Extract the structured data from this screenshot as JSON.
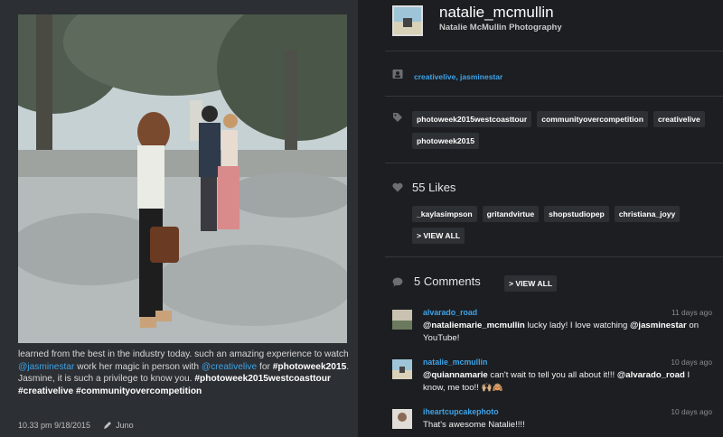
{
  "post": {
    "caption": {
      "part1": "learned from the best in the industry today. such an amazing experience to watch ",
      "mention1": "@jasminestar",
      "part2": " work her magic in person with ",
      "mention2": "@creativelive",
      "part3": " for ",
      "hashtag1": "#photoweek2015",
      "part4": ". Jasmine, it is such a privilege to know you. ",
      "hashtag2": "#photoweek2015westcoasttour",
      "hashtag3": "#creativelive",
      "hashtag4": "#communityovercompetition"
    },
    "timestamp": "10.33 pm 9/18/2015",
    "filter": "Juno"
  },
  "profile": {
    "username": "natalie_mcmullin",
    "fullname": "Natalie McMullin Photography"
  },
  "people": "creativelive, jasminestar",
  "tags": [
    "photoweek2015westcoasttour",
    "communityovercompetition",
    "creativelive",
    "photoweek2015"
  ],
  "likes": {
    "count_label": "55 Likes",
    "users": [
      "_kaylasimpson",
      "gritandvirtue",
      "shopstudiopep",
      "christiana_joyy"
    ],
    "view_all": "> VIEW ALL"
  },
  "comments": {
    "count_label": "5 Comments",
    "view_all": "> VIEW ALL",
    "items": [
      {
        "user": "alvarado_road",
        "time": "11 days ago",
        "text_m1": "@nataliemarie_mcmullin",
        "text_1": " lucky lady! I love watching ",
        "text_m2": "@jasminestar",
        "text_2": " on YouTube!"
      },
      {
        "user": "natalie_mcmullin",
        "time": "10 days ago",
        "text_m1": "@quiannamarie",
        "text_1": " can't wait to tell you all about it!!! ",
        "text_m2": "@alvarado_road",
        "text_2": " I know, me too!! 🙌🏼🙈"
      },
      {
        "user": "iheartcupcakephoto",
        "time": "10 days ago",
        "text_1": "That's awesome Natalie!!!!"
      }
    ]
  },
  "colors": {
    "accent": "#3ea3e8",
    "panel_left": "#2c2f33",
    "panel_right": "#1c1e21",
    "tag_bg": "#2d3034"
  },
  "icons": [
    "person-tag-icon",
    "tag-icon",
    "heart-icon",
    "comment-icon",
    "pencil-icon"
  ]
}
